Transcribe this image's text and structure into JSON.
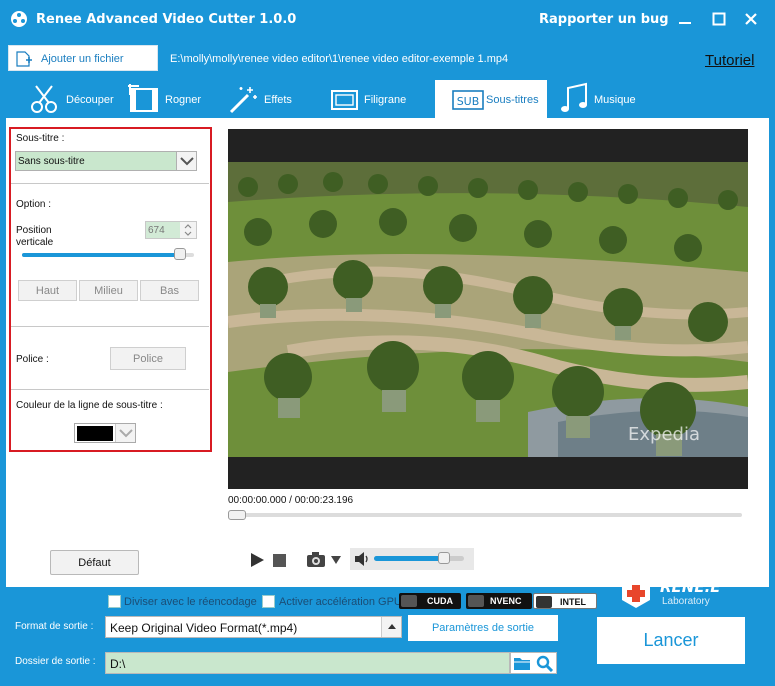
{
  "app": {
    "title": "Renee Advanced Video Cutter 1.0.0",
    "report_bug": "Rapporter un bug"
  },
  "toolbar": {
    "add_file": "Ajouter un fichier",
    "file_path": "E:\\molly\\molly\\renee video editor\\1\\renee video editor-exemple 1.mp4",
    "tutorial": "Tutoriel"
  },
  "tabs": [
    {
      "label": "Découper",
      "icon": "scissors-icon"
    },
    {
      "label": "Rogner",
      "icon": "film-crop-icon"
    },
    {
      "label": "Effets",
      "icon": "magic-wand-icon"
    },
    {
      "label": "Filigrane",
      "icon": "watermark-icon"
    },
    {
      "label": "Sous-titres",
      "icon": "subtitle-icon",
      "badge": "SUB",
      "active": true
    },
    {
      "label": "Musique",
      "icon": "music-note-icon"
    }
  ],
  "subtitle_panel": {
    "subtitle_label": "Sous-titre :",
    "subtitle_selected": "Sans sous-titre",
    "option_label": "Option :",
    "vertical_position_label_1": "Position",
    "vertical_position_label_2": "verticale",
    "vertical_position_value": "674",
    "vertical_position_fraction": 0.92,
    "position_buttons": [
      "Haut",
      "Milieu",
      "Bas"
    ],
    "font_label": "Police :",
    "font_button": "Police",
    "line_color_label": "Couleur de la ligne de sous-titre :",
    "line_color": "#000000",
    "default_button": "Défaut"
  },
  "player": {
    "time": "00:00:00.000 / 00:00:23.196",
    "seek_fraction": 0.0,
    "volume_fraction": 0.78,
    "watermark": "Expedia"
  },
  "output": {
    "split_reencode": "Diviser avec le réencodage",
    "gpu_accel": "Activer accélération GPU",
    "gpu_badges": [
      "CUDA",
      "NVENC",
      "INTEL"
    ],
    "format_label": "Format de sortie :",
    "format_value": "Keep Original Video Format(*.mp4)",
    "params_button": "Paramètres de sortie",
    "folder_label": "Dossier de sortie :",
    "folder_value": "D:\\",
    "launch_button": "Lancer",
    "logo_name": "RENE.E",
    "logo_sub": "Laboratory"
  },
  "colors": {
    "brand_blue": "#1a96d8",
    "highlight_red": "#d81b23",
    "field_green": "#c9e7cd"
  }
}
